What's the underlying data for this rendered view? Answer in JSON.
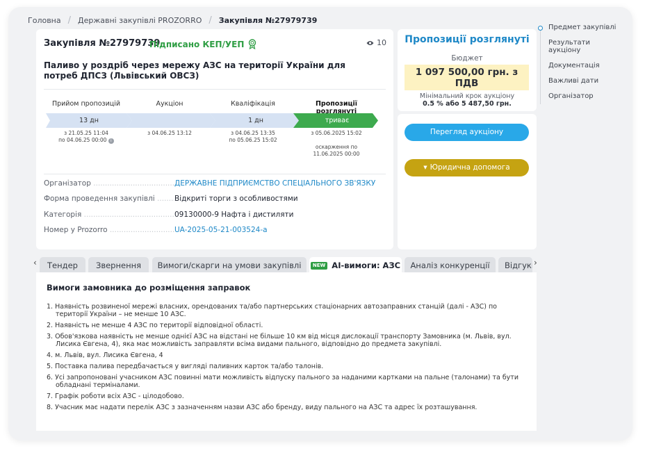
{
  "breadcrumb": [
    "Головна",
    "Державні закупівлі PROZORRO",
    "Закупівля №27979739"
  ],
  "tender": {
    "title": "Закупівля №27979739",
    "signed": "Підписано КЕП/УЕП",
    "views": "10",
    "subject": "Паливо у роздріб через мережу АЗС на території України для потреб ДПСЗ (Львівський ОВСЗ)"
  },
  "stages": [
    {
      "label": "Прийом пропозицій",
      "bar": "13 дн",
      "date": "з 21.05.25 11:04\nпо 04.06.25 00:00",
      "active": false
    },
    {
      "label": "Аукціон",
      "bar": "",
      "date": "з 04.06.25 13:12",
      "active": false
    },
    {
      "label": "Кваліфікація",
      "bar": "1 дн",
      "date": "з 04.06.25 13:35\nпо 05.06.25 15:02",
      "active": false
    },
    {
      "label": "Пропозиції розглянуті",
      "bar": "триває",
      "date": "з 05.06.2025 15:02\n \nоскарження по\n11.06.2025 00:00",
      "active": true
    }
  ],
  "info": [
    {
      "label": "Організатор",
      "value": "ДЕРЖАВНЕ ПІДПРИЄМСТВО СПЕЦІАЛЬНОГО ЗВ'ЯЗКУ",
      "link": true
    },
    {
      "label": "Форма проведення закупівлі",
      "value": "Відкриті торги з особливостями",
      "link": false
    },
    {
      "label": "Категорія",
      "value": "09130000-9 Нафта і дистиляти",
      "link": false
    },
    {
      "label": "Номер у Prozorro",
      "value": "UA-2025-05-21-003524-a",
      "link": true
    }
  ],
  "side": {
    "status": "Пропозиції розглянуті",
    "budget_label": "Бюджет",
    "budget_value": "1 097 500,00 грн. з ПДВ",
    "min_step_label": "Мінімальний крок аукціону",
    "min_step_value": "0.5 % або 5 487,50 грн.",
    "auction_button": "Перегляд аукціону",
    "legal_button": "Юридична допомога"
  },
  "toc": [
    "Предмет закупівлі",
    "Результати аукціону",
    "Документація",
    "Важливі дати",
    "Організатор"
  ],
  "tabs": [
    "Тендер",
    "Звернення",
    "Вимоги/скарги на умови закупівлі",
    "AI-вимоги: АЗС",
    "Аналіз конкуренції",
    "Відгуки"
  ],
  "tab_badge": "NEW",
  "requirements": {
    "title": "Вимоги замовника до розміщення заправок",
    "items": [
      "Наявність розвиненої мережі власних, орендованих та/або партнерських стаціонарних автозаправних станцій (далі - АЗС) по території України – не менше 10 АЗС.",
      "Наявність не менше 4 АЗС по території відповідної області.",
      "Обов'язкова наявність не менше однієї АЗС на відстані не більше 10 км від місця дислокації транспорту Замовника (м. Львів, вул. Лисика Євгена, 4), яка має можливість заправляти всіма видами пального, відповідно до предмета закупівлі.",
      "м. Львів, вул. Лисика Євгена, 4",
      "Поставка палива передбачається у вигляді паливних карток та/або талонів.",
      "Усі запропоновані учасником АЗС повинні мати можливість відпуску пального за наданими картками на пальне (талонами) та бути обладнані терміналами.",
      "Графік роботи всіх АЗС - цілодобово.",
      "Учасник має надати перелік АЗС з зазначенням назви АЗС або бренду, виду пального на АЗС та адрес їх розташування."
    ]
  }
}
